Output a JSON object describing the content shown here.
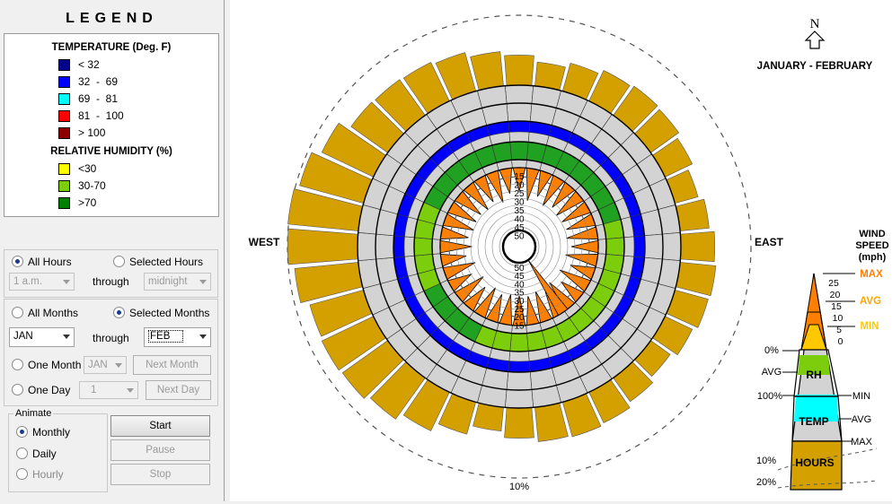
{
  "legend": {
    "title": "LEGEND",
    "temperature_heading": "TEMPERATURE (Deg. F)",
    "temperature_items": [
      {
        "label": "< 32",
        "color": "#00008b"
      },
      {
        "label": "32  -  69",
        "color": "#0000ff"
      },
      {
        "label": "69  -  81",
        "color": "#00ffff"
      },
      {
        "label": "81  -  100",
        "color": "#ff0000"
      },
      {
        "label": "> 100",
        "color": "#8b0000"
      }
    ],
    "humidity_heading": "RELATIVE HUMIDITY (%)",
    "humidity_items": [
      {
        "label": "<30",
        "color": "#ffff00"
      },
      {
        "label": "30-70",
        "color": "#7ccd0c"
      },
      {
        "label": ">70",
        "color": "#008000"
      }
    ]
  },
  "hours": {
    "all_hours_label": "All Hours",
    "selected_hours_label": "Selected Hours",
    "selected": "all",
    "from_value": "1 a.m.",
    "through_label": "through",
    "to_value": "midnight"
  },
  "months": {
    "all_months_label": "All Months",
    "selected_months_label": "Selected Months",
    "selected": "selected",
    "from_value": "JAN",
    "through_label": "through",
    "to_value": "FEB",
    "one_month_label": "One Month",
    "one_month_value": "JAN",
    "next_month_label": "Next Month",
    "one_day_label": "One Day",
    "one_day_value": "1",
    "next_day_label": "Next Day"
  },
  "animate": {
    "group_label": "Animate",
    "monthly_label": "Monthly",
    "daily_label": "Daily",
    "hourly_label": "Hourly",
    "selected": "monthly",
    "start_label": "Start",
    "pause_label": "Pause",
    "stop_label": "Stop"
  },
  "chart": {
    "north_label": "N",
    "period_label": "JANUARY - FEBRUARY",
    "west_label": "WEST",
    "east_label": "EAST",
    "outer_ring_label": "10%",
    "wind_scale_labels_top": [
      "15",
      "20",
      "25",
      "30",
      "35",
      "40",
      "45",
      "50"
    ],
    "wind_scale_labels_bottom": [
      "50",
      "45",
      "40",
      "35",
      "30",
      "25",
      "20",
      "15"
    ],
    "colors": {
      "hours": "#d4a000",
      "rh_green": "#7ccd0c",
      "rh_dark": "#21a121",
      "temp_blue": "#0000ff",
      "gray": "#d3d3d3",
      "wind": "#ff8000",
      "wind_min": "#ffc800"
    }
  },
  "key": {
    "title_line1": "WIND",
    "title_line2": "SPEED",
    "title_line3": "(mph)",
    "max_label": "MAX",
    "avg_label": "AVG",
    "min_label": "MIN",
    "speed_ticks": [
      "25",
      "20",
      "15",
      "10",
      "5",
      "0"
    ],
    "rh_zero": "0%",
    "rh_avg": "AVG",
    "rh_label": "RH",
    "rh_hundred": "100%",
    "rh_min": "MIN",
    "temp_label": "TEMP",
    "temp_avg": "AVG",
    "temp_max": "MAX",
    "hours_ten": "10%",
    "hours_label": "HOURS",
    "hours_twenty": "20%"
  }
}
